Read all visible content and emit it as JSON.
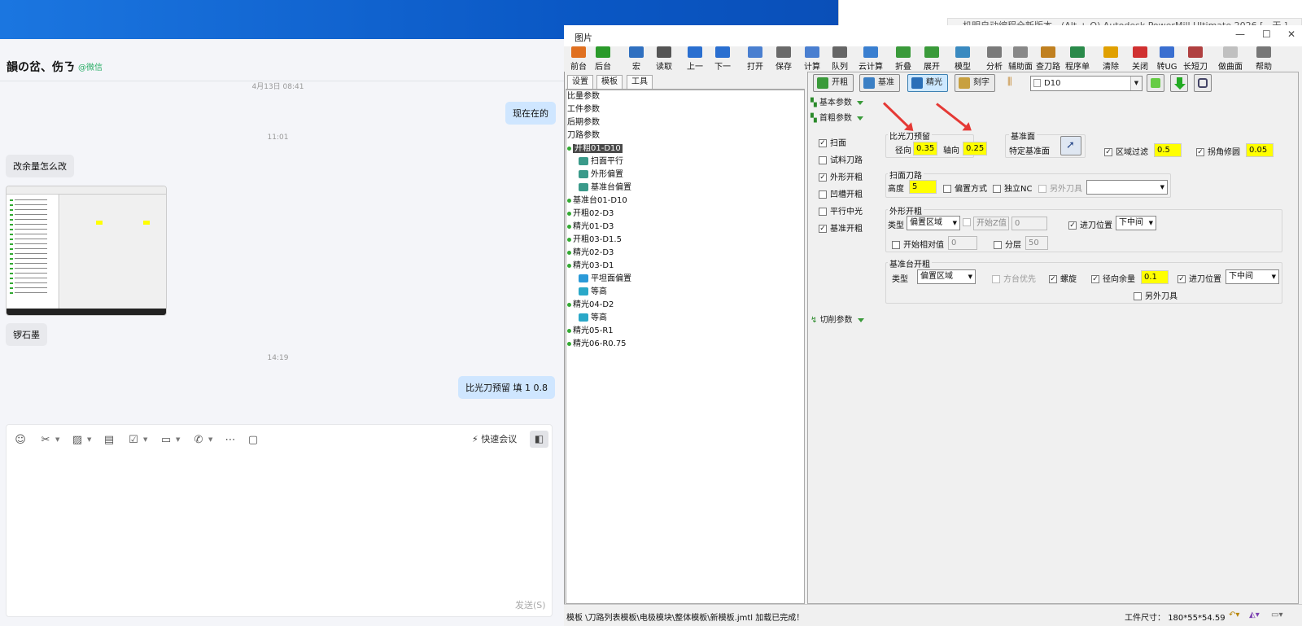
{
  "background_window": {
    "title": "机明自动编程全新版本 - (Alt + Q) Autodesk PowerMill Ultimate 2026   [ - 无 ]"
  },
  "chat": {
    "contact_name": "韻の岔、伤ㄋ",
    "contact_source": "@微信",
    "messages": [
      {
        "type": "time",
        "text": "4月13日 08:41"
      },
      {
        "type": "me",
        "text": "现在在的"
      },
      {
        "type": "time",
        "text": "11:01"
      },
      {
        "type": "other",
        "text": "改余量怎么改"
      },
      {
        "type": "other_image"
      },
      {
        "type": "other",
        "text": "锣石墨"
      },
      {
        "type": "time",
        "text": "14:19"
      },
      {
        "type": "me",
        "text": "比光刀预留 填 1  0.8"
      }
    ],
    "toolbar_icons": [
      "emoji-icon",
      "scissors-icon",
      "image-icon",
      "document-icon",
      "task-icon",
      "folder-icon",
      "phone-icon",
      "more-icon",
      "screen-icon"
    ],
    "quick_meeting": "快速会议",
    "send_label": "发送(S)"
  },
  "powermill": {
    "window_title": "图片",
    "toolbar": [
      "前台",
      "后台",
      "宏",
      "读取",
      "上一",
      "下一",
      "打开",
      "保存",
      "计算",
      "队列",
      "云计算",
      "折叠",
      "展开",
      "模型",
      "分析",
      "辅助面",
      "查刀路",
      "程序单",
      "清除",
      "关闭",
      "转UG",
      "长短刀",
      "做曲面",
      "帮助"
    ],
    "tabs": [
      "设置",
      "模板",
      "工具"
    ],
    "tree": [
      {
        "text": "比量参数",
        "level": 0
      },
      {
        "text": "工件参数",
        "level": 0
      },
      {
        "text": "后期参数",
        "level": 0
      },
      {
        "text": "刀路参数",
        "level": 0
      },
      {
        "text": "开粗01-D10",
        "level": 1,
        "selected": true
      },
      {
        "text": "扫面平行",
        "level": 2
      },
      {
        "text": "外形偏置",
        "level": 2
      },
      {
        "text": "基准台偏置",
        "level": 2
      },
      {
        "text": "基准台01-D10",
        "level": 1
      },
      {
        "text": "开粗02-D3",
        "level": 1
      },
      {
        "text": "精光01-D3",
        "level": 1
      },
      {
        "text": "开粗03-D1.5",
        "level": 1
      },
      {
        "text": "精光02-D3",
        "level": 1
      },
      {
        "text": "精光03-D1",
        "level": 1
      },
      {
        "text": "平坦面偏置",
        "level": 2
      },
      {
        "text": "等高",
        "level": 2
      },
      {
        "text": "精光04-D2",
        "level": 1
      },
      {
        "text": "等高",
        "level": 2
      },
      {
        "text": "精光05-R1",
        "level": 1
      },
      {
        "text": "精光06-R0.75",
        "level": 1
      }
    ],
    "mode_buttons": [
      "开粗",
      "基准",
      "精光",
      "刻字"
    ],
    "tool_select": "D10",
    "sections": {
      "basic": "基本参数",
      "rough": "首粗参数",
      "cut": "切削参数"
    },
    "left_checks": [
      {
        "label": "扫面",
        "checked": true
      },
      {
        "label": "试料刀路",
        "checked": false
      },
      {
        "label": "外形开粗",
        "checked": true
      },
      {
        "label": "凹槽开粗",
        "checked": false
      },
      {
        "label": "平行中光",
        "checked": false
      },
      {
        "label": "基准开粗",
        "checked": true
      }
    ],
    "finish_allow": {
      "title": "比光刀预留",
      "radial_label": "径向",
      "radial": "0.35",
      "axial_label": "轴向",
      "axial": "0.25"
    },
    "datum_face": {
      "title": "基准面",
      "label": "特定基准面"
    },
    "region_filter": {
      "label": "区域过滤",
      "value": "0.5",
      "checked": true
    },
    "corner_fillet": {
      "label": "拐角修圆",
      "value": "0.05",
      "checked": true
    },
    "face_path": {
      "title": "扫面刀路",
      "height_label": "高度",
      "height": "5",
      "offset_label": "偏置方式",
      "nc_label": "独立NC",
      "other_tool_label": "另外刀具"
    },
    "outline_rough": {
      "title": "外形开粗",
      "type_label": "类型",
      "type": "偏置区域",
      "startz_label": "开始Z值",
      "startz": "0",
      "entry_label": "进刀位置",
      "entry": "下中间",
      "relative_label": "开始相对值",
      "relative": "0",
      "layers_label": "分层",
      "layers": "50"
    },
    "datum_rough": {
      "title": "基准台开粗",
      "type_label": "类型",
      "type": "偏置区域",
      "square_label": "方台优先",
      "spiral_label": "螺旋",
      "radial_label": "径向余量",
      "radial": "0.1",
      "entry_label": "进刀位置",
      "entry": "下中间",
      "other_tool_label": "另外刀具"
    },
    "status_text": "模板  \\刀路列表模板\\电极模块\\整体模板\\新模板.jmtl 加载已完成！",
    "status_size_label": "工件尺寸：",
    "status_size": "180*55*54.59"
  }
}
